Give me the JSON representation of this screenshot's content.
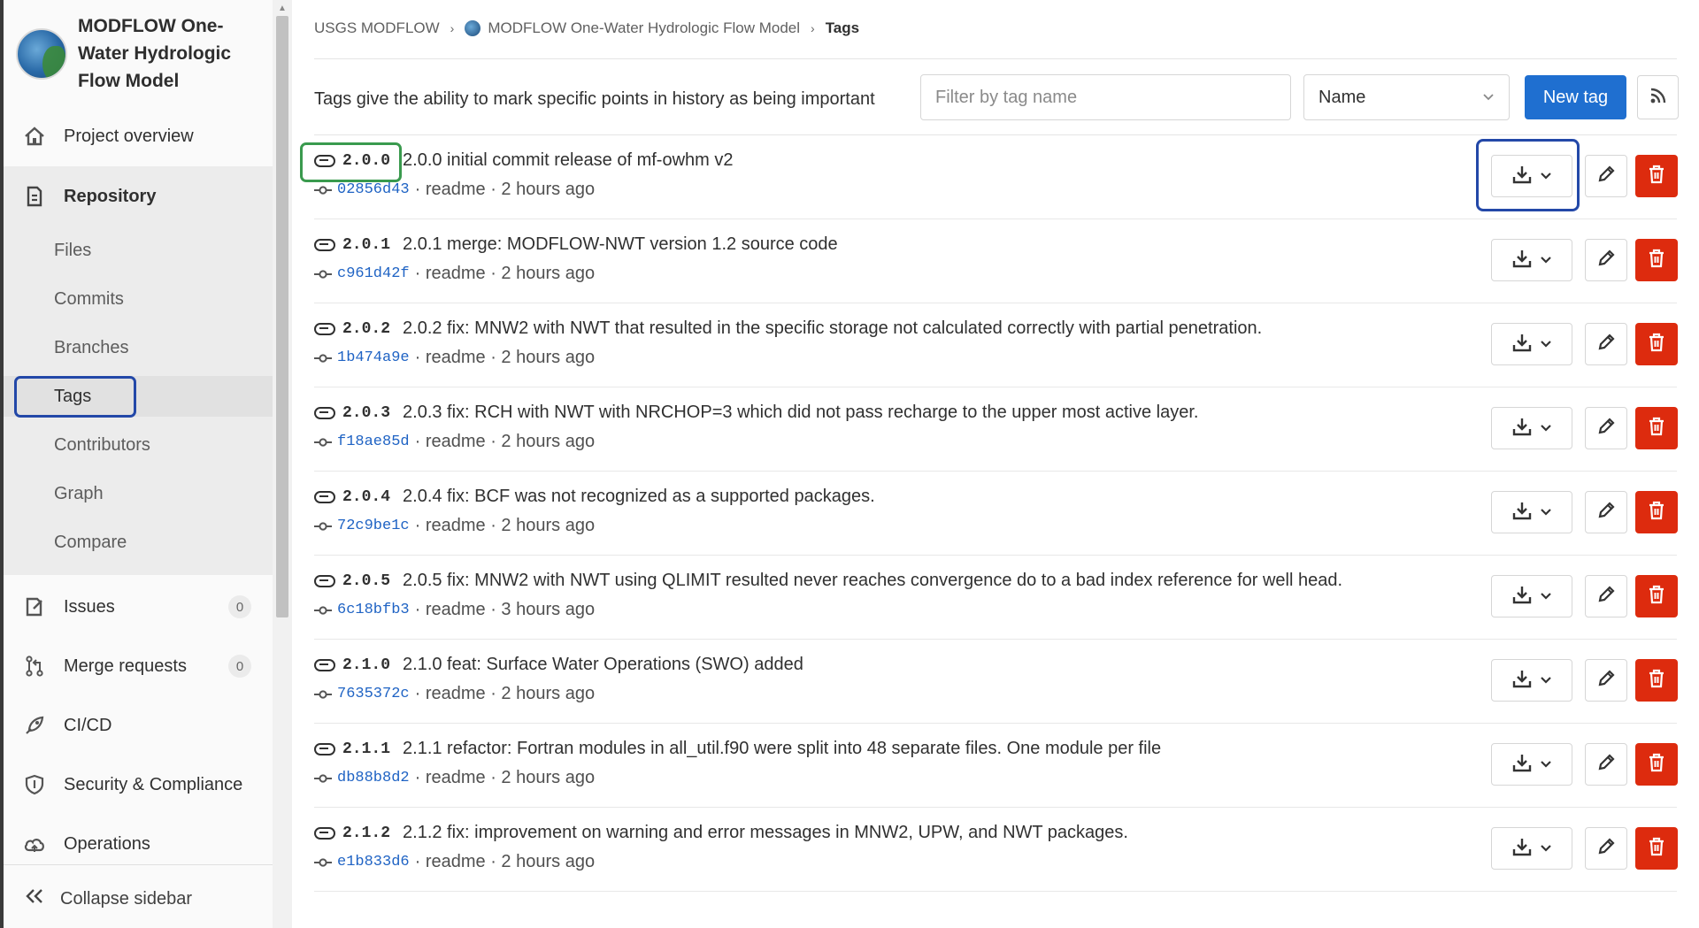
{
  "project": {
    "title": "MODFLOW One-Water Hydrologic Flow Model"
  },
  "sidebar": {
    "project_overview": "Project overview",
    "repository": "Repository",
    "repo_items": [
      {
        "label": "Files"
      },
      {
        "label": "Commits"
      },
      {
        "label": "Branches"
      },
      {
        "label": "Tags"
      },
      {
        "label": "Contributors"
      },
      {
        "label": "Graph"
      },
      {
        "label": "Compare"
      }
    ],
    "issues": {
      "label": "Issues",
      "count": "0"
    },
    "merge_requests": {
      "label": "Merge requests",
      "count": "0"
    },
    "cicd": "CI/CD",
    "security": "Security & Compliance",
    "operations": "Operations",
    "collapse": "Collapse sidebar"
  },
  "breadcrumb": {
    "group": "USGS MODFLOW",
    "project": "MODFLOW One-Water Hydrologic Flow Model",
    "current": "Tags"
  },
  "toolbar": {
    "description": "Tags give the ability to mark specific points in history as being important",
    "filter_placeholder": "Filter by tag name",
    "sort_value": "Name",
    "new_tag": "New tag"
  },
  "tags": [
    {
      "name": "2.0.0",
      "message": "2.0.0 initial commit release of mf-owhm v2",
      "sha": "02856d43",
      "meta": "· readme · 2 hours ago"
    },
    {
      "name": "2.0.1",
      "message": "2.0.1 merge: MODFLOW-NWT version 1.2 source code",
      "sha": "c961d42f",
      "meta": "· readme · 2 hours ago"
    },
    {
      "name": "2.0.2",
      "message": "2.0.2 fix: MNW2 with NWT that resulted in the specific storage not calculated correctly with partial penetration.",
      "sha": "1b474a9e",
      "meta": "· readme · 2 hours ago"
    },
    {
      "name": "2.0.3",
      "message": "2.0.3 fix: RCH with NWT with NRCHOP=3 which did not pass recharge to the upper most active layer.",
      "sha": "f18ae85d",
      "meta": "· readme · 2 hours ago"
    },
    {
      "name": "2.0.4",
      "message": "2.0.4 fix: BCF was not recognized as a supported packages.",
      "sha": "72c9be1c",
      "meta": "· readme · 2 hours ago"
    },
    {
      "name": "2.0.5",
      "message": "2.0.5 fix: MNW2 with NWT using QLIMIT resulted never reaches convergence do to a bad index reference for well head.",
      "sha": "6c18bfb3",
      "meta": "· readme · 3 hours ago"
    },
    {
      "name": "2.1.0",
      "message": "2.1.0 feat: Surface Water Operations (SWO) added",
      "sha": "7635372c",
      "meta": "· readme · 2 hours ago"
    },
    {
      "name": "2.1.1",
      "message": "2.1.1 refactor: Fortran modules in all_util.f90 were split into 48 separate files. One module per file",
      "sha": "db88b8d2",
      "meta": "· readme · 2 hours ago"
    },
    {
      "name": "2.1.2",
      "message": "2.1.2 fix: improvement on warning and error messages in MNW2, UPW, and NWT packages.",
      "sha": "e1b833d6",
      "meta": "· readme · 2 hours ago"
    }
  ],
  "colors": {
    "primary": "#1f6fd0",
    "danger": "#dd2b0e",
    "link": "#1f63c4",
    "highlight_green": "#3a9a4e",
    "highlight_blue": "#2348a8"
  },
  "icons": [
    "home-icon",
    "repository-icon",
    "issues-icon",
    "merge-request-icon",
    "rocket-icon",
    "shield-icon",
    "cloud-icon",
    "chevrons-left-icon",
    "tag-icon",
    "commit-icon",
    "download-icon",
    "chevron-down-icon",
    "pencil-icon",
    "trash-icon",
    "rss-icon"
  ]
}
